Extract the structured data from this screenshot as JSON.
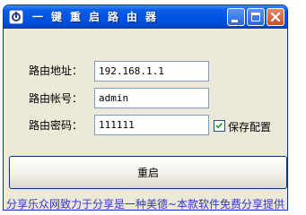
{
  "window": {
    "title": "一键重启路由器",
    "controls": {
      "minimize": "minimize",
      "maximize": "maximize",
      "close": "close"
    }
  },
  "form": {
    "ip_label": "路由地址：",
    "ip_value": "192.168.1.1",
    "user_label": "路由帐号：",
    "user_value": "admin",
    "password_label": "路由密码：",
    "password_value": "111111",
    "save_label": "保存配置",
    "save_checked": true
  },
  "restart_button": "重启",
  "footer_text": "分享乐众网致力于分享是一种美德~本款软件免费分享提供",
  "colors": {
    "titlebar": "#0054e3",
    "window_bg": "#ece9d8",
    "close_button": "#c94f2c",
    "footer_text": "#3333cc"
  },
  "icons": [
    "power-icon",
    "minimize-icon",
    "maximize-icon",
    "close-icon",
    "checkmark-icon"
  ]
}
